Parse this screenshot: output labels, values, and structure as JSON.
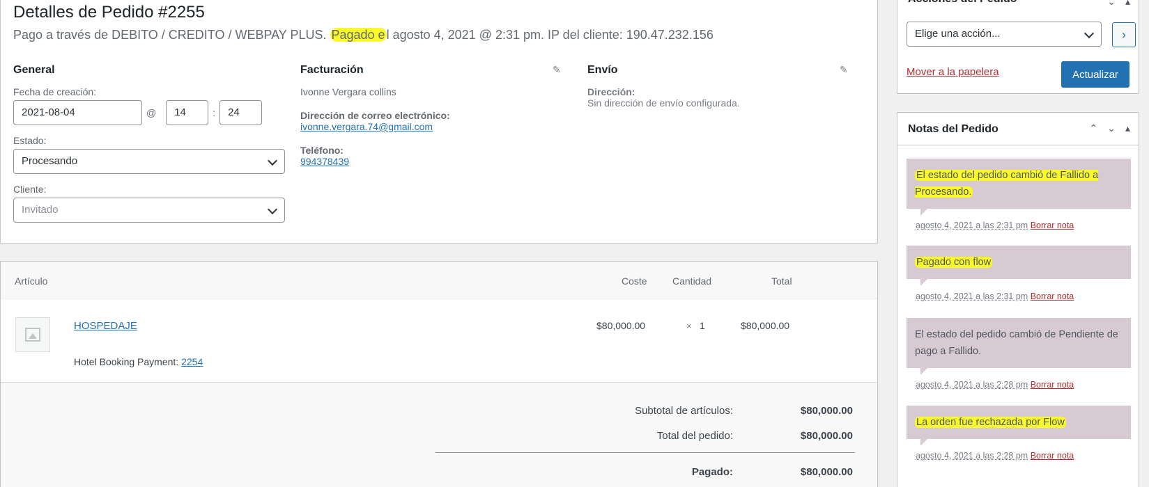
{
  "order": {
    "title": "Detalles de Pedido #2255",
    "subtitle_pre": "Pago a través de DEBITO / CREDITO / WEBPAY PLUS. ",
    "subtitle_hl": "Pagado e",
    "subtitle_post": "l agosto 4, 2021 @ 2:31 pm. IP del cliente: 190.47.232.156"
  },
  "general": {
    "heading": "General",
    "created_label": "Fecha de creación:",
    "date": "2021-08-04",
    "at": "@",
    "hour": "14",
    "colon": ":",
    "minute": "24",
    "status_label": "Estado:",
    "status_value": "Procesando",
    "customer_label": "Cliente:",
    "customer_value": "Invitado"
  },
  "billing": {
    "heading": "Facturación",
    "name": "Ivonne Vergara collins",
    "email_label": "Dirección de correo electrónico:",
    "email": "ivonne.vergara.74@gmail.com",
    "phone_label": "Teléfono:",
    "phone": "994378439"
  },
  "shipping": {
    "heading": "Envío",
    "address_label": "Dirección:",
    "address_value": "Sin dirección de envío configurada."
  },
  "items": {
    "headers": {
      "article": "Artículo",
      "cost": "Coste",
      "qty": "Cantidad",
      "total": "Total"
    },
    "row": {
      "name": "HOSPEDAJE",
      "cost": "$80,000.00",
      "qty_x": "×",
      "qty": "1",
      "total": "$80,000.00",
      "meta_label": "Hotel Booking Payment:",
      "meta_link": "2254"
    },
    "subtotal_label": "Subtotal de artículos:",
    "subtotal_value": "$80,000.00",
    "total_label": "Total del pedido:",
    "total_value": "$80,000.00",
    "cut_label": "Pagado:",
    "cut_value": "$80,000.00"
  },
  "actions": {
    "title": "Acciones del Pedido",
    "select": "Elige una acción...",
    "trash": "Mover a la papelera",
    "update": "Actualizar"
  },
  "notes": {
    "title": "Notas del Pedido",
    "list": [
      {
        "text": "El estado del pedido cambió de Fallido a Procesando.",
        "date": "agosto 4, 2021 a las 2:31 pm",
        "delete": "Borrar nota"
      },
      {
        "text": "Pagado con flow",
        "date": "agosto 4, 2021 a las 2:31 pm",
        "delete": "Borrar nota"
      },
      {
        "text": "El estado del pedido cambió de Pendiente de pago a Fallido.",
        "date": "agosto 4, 2021 a las 2:28 pm",
        "delete": "Borrar nota"
      },
      {
        "text": "La orden fue rechazada por Flow",
        "date": "agosto 4, 2021 a las 2:28 pm",
        "delete": "Borrar nota"
      }
    ]
  },
  "colors": {
    "accent": "#2271b1",
    "note_bg": "#d7cad2",
    "highlight": "#f8f82a",
    "danger": "#b32d2e"
  }
}
